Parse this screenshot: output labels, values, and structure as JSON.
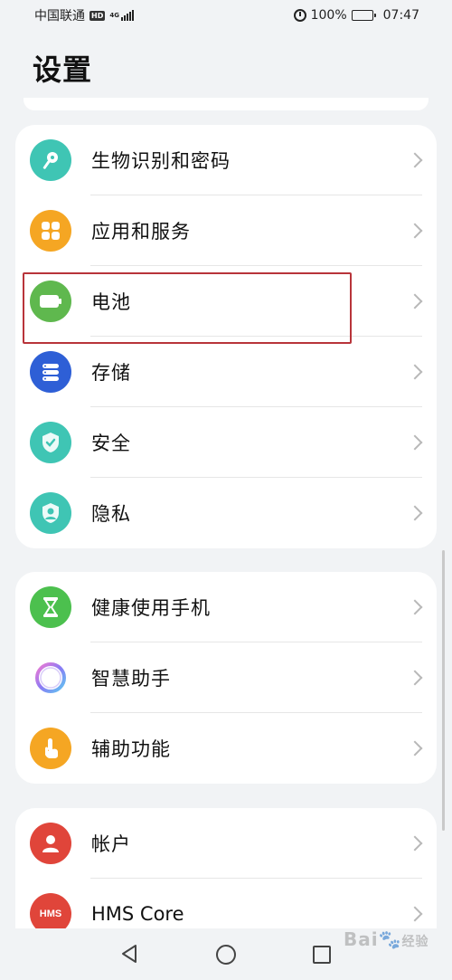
{
  "status_bar": {
    "carrier": "中国联通",
    "hd_badge": "HD",
    "network": "4G",
    "battery_percent": "100%",
    "time": "07:47"
  },
  "page_title": "设置",
  "groups": [
    {
      "items": [
        {
          "label": "生物识别和密码",
          "icon": "key-icon",
          "color": "#3fc5b4"
        },
        {
          "label": "应用和服务",
          "icon": "apps-grid-icon",
          "color": "#f5a623"
        },
        {
          "label": "电池",
          "icon": "battery-icon",
          "color": "#5fb84e"
        },
        {
          "label": "存储",
          "icon": "storage-icon",
          "color": "#2e5fd6"
        },
        {
          "label": "安全",
          "icon": "shield-icon",
          "color": "#3fc5b4"
        },
        {
          "label": "隐私",
          "icon": "privacy-icon",
          "color": "#3fc5b4"
        }
      ]
    },
    {
      "items": [
        {
          "label": "健康使用手机",
          "icon": "hourglass-icon",
          "color": "#4cc04e"
        },
        {
          "label": "智慧助手",
          "icon": "assistant-ring-icon",
          "color": "#9b7bf0"
        },
        {
          "label": "辅助功能",
          "icon": "hand-icon",
          "color": "#f5a623"
        }
      ]
    },
    {
      "items": [
        {
          "label": "帐户",
          "icon": "account-icon",
          "color": "#e0453a"
        },
        {
          "label": "HMS Core",
          "icon": "hms-icon",
          "color": "#e0453a"
        }
      ]
    }
  ],
  "hms_icon_text": "HMS",
  "watermark": {
    "text": "Bai",
    "sub": "经验"
  },
  "accent_colors": {
    "highlight": "#b8343a",
    "background": "#f1f3f5"
  }
}
